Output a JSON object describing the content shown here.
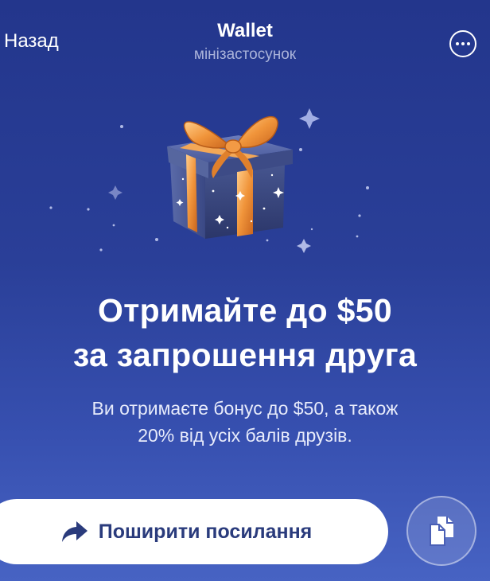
{
  "header": {
    "back_label": "Назад",
    "title": "Wallet",
    "subtitle": "мінізастосунок",
    "menu_icon": "more-horizontal-icon"
  },
  "hero": {
    "illustration": "gift-box-icon",
    "headline_line1": "Отримайте до $50",
    "headline_line2": "за запрошення друга",
    "description_line1": "Ви отримаєте бонус до $50, а також",
    "description_line2": "20% від усіх балів друзів."
  },
  "actions": {
    "share_label": "Поширити посилання",
    "share_icon": "share-arrow-icon",
    "copy_icon": "copy-icon"
  },
  "colors": {
    "background_top": "#23368c",
    "background_bottom": "#4763c3",
    "button_text": "#2a3b7c",
    "ribbon": "#f0943a"
  }
}
